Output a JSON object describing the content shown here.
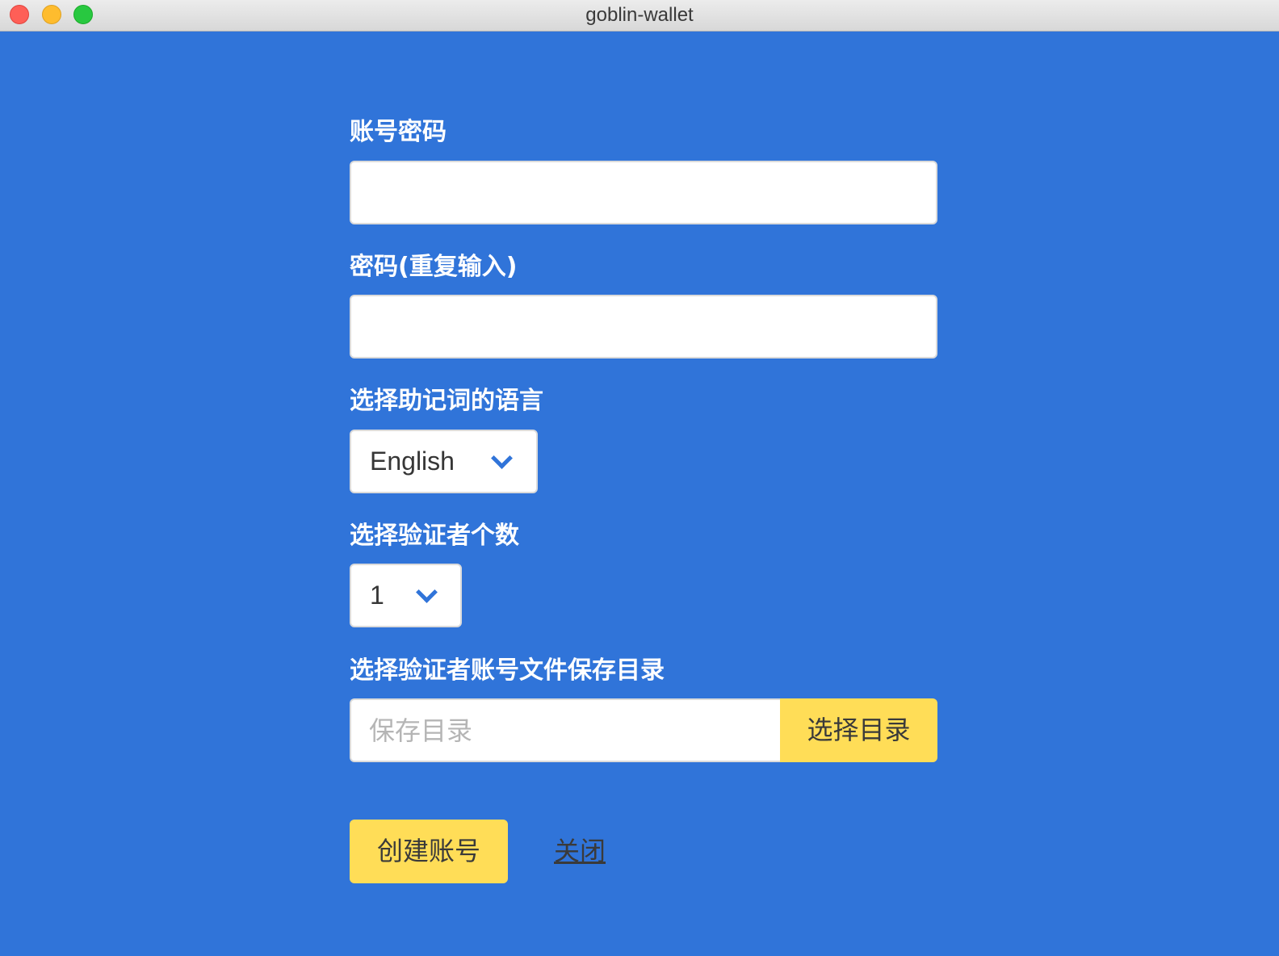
{
  "window": {
    "title": "goblin-wallet"
  },
  "form": {
    "password": {
      "label": "账号密码",
      "value": ""
    },
    "password_repeat": {
      "label": "密码(重复输入)",
      "value": ""
    },
    "mnemonic_language": {
      "label": "选择助记词的语言",
      "selected": "English"
    },
    "validator_count": {
      "label": "选择验证者个数",
      "selected": "1"
    },
    "save_directory": {
      "label": "选择验证者账号文件保存目录",
      "placeholder": "保存目录",
      "value": "",
      "button_label": "选择目录"
    },
    "actions": {
      "create_label": "创建账号",
      "close_label": "关闭"
    }
  },
  "colors": {
    "background": "#3074d9",
    "accent_button": "#ffdd57",
    "chevron": "#3074d9"
  }
}
